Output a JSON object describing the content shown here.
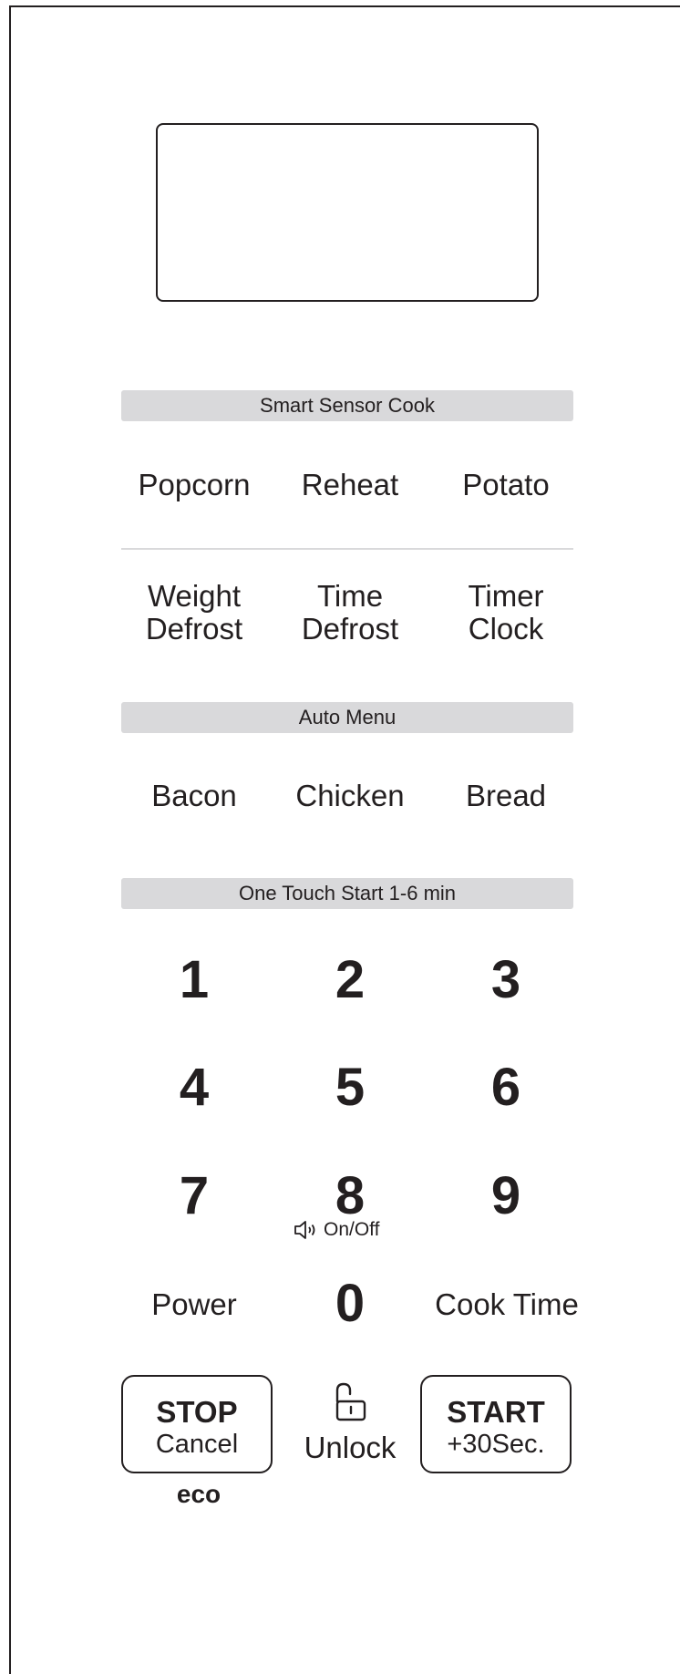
{
  "display": {
    "text": ""
  },
  "sections": {
    "smart_sensor": "Smart Sensor Cook",
    "auto_menu": "Auto Menu",
    "one_touch": "One Touch Start 1-6 min"
  },
  "sensor_keys": {
    "popcorn": "Popcorn",
    "reheat": "Reheat",
    "potato": "Potato"
  },
  "defrost_keys": {
    "weight": [
      "Weight",
      "Defrost"
    ],
    "time": [
      "Time",
      "Defrost"
    ],
    "timer": [
      "Timer",
      "Clock"
    ]
  },
  "auto_keys": {
    "bacon": "Bacon",
    "chicken": "Chicken",
    "bread": "Bread"
  },
  "numpad": [
    "1",
    "2",
    "3",
    "4",
    "5",
    "6",
    "7",
    "8",
    "9",
    "0"
  ],
  "sound_label": "On/Off",
  "bottom_keys": {
    "power": "Power",
    "cook_time": "Cook Time"
  },
  "stop": {
    "line1": "STOP",
    "line2": "Cancel",
    "eco": "eco"
  },
  "unlock": {
    "label": "Unlock"
  },
  "start": {
    "line1": "START",
    "line2": "+30Sec."
  }
}
